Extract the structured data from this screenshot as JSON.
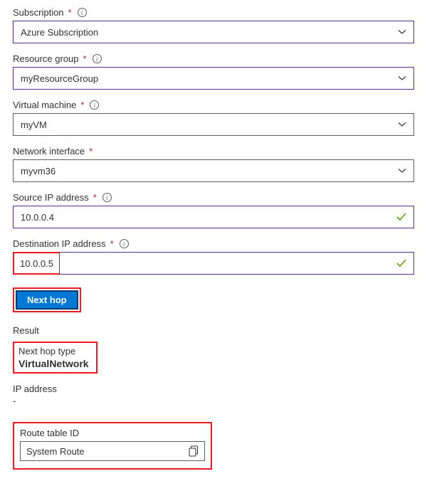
{
  "fields": {
    "subscription": {
      "label": "Subscription",
      "value": "Azure Subscription"
    },
    "resourceGroup": {
      "label": "Resource group",
      "value": "myResourceGroup"
    },
    "virtualMachine": {
      "label": "Virtual machine",
      "value": "myVM"
    },
    "networkInterface": {
      "label": "Network interface",
      "value": "myvm36"
    },
    "sourceIp": {
      "label": "Source IP address",
      "value": "10.0.0.4"
    },
    "destinationIp": {
      "label": "Destination IP address",
      "value": "10.0.0.5"
    }
  },
  "button": {
    "nextHop": "Next hop"
  },
  "result": {
    "header": "Result",
    "nextHopTypeLabel": "Next hop type",
    "nextHopTypeValue": "VirtualNetwork",
    "ipAddressLabel": "IP address",
    "ipAddressValue": "-",
    "routeTableLabel": "Route table ID",
    "routeTableValue": "System Route"
  }
}
